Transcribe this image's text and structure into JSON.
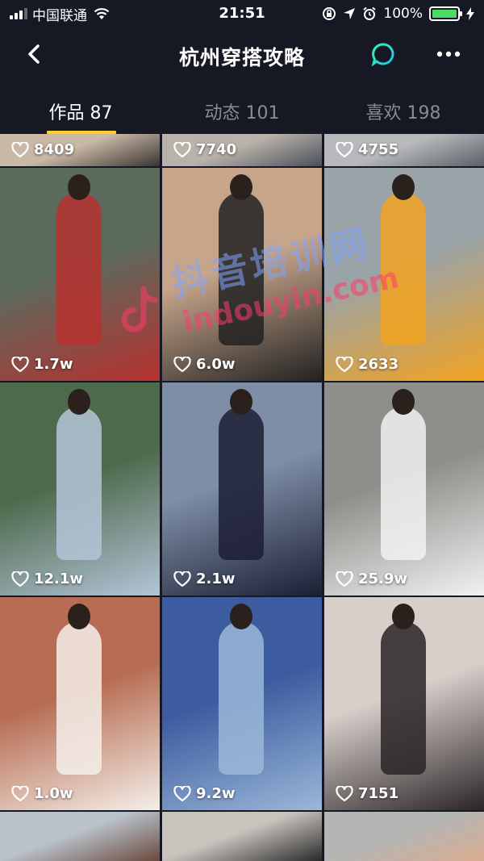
{
  "status_bar": {
    "carrier": "中国联通",
    "time": "21:51",
    "battery": "100%",
    "battery_level": 1.0
  },
  "nav": {
    "title": "杭州穿搭攻略"
  },
  "tabs": [
    {
      "label": "作品 87",
      "active": true
    },
    {
      "label": "动态 101",
      "active": false
    },
    {
      "label": "喜欢 198",
      "active": false
    }
  ],
  "watermark": {
    "cn": "抖音培训网",
    "en": "indouyin.com"
  },
  "videos": [
    {
      "likes": "8409",
      "colors": [
        "#c9b8a6",
        "#3a3531"
      ]
    },
    {
      "likes": "7740",
      "colors": [
        "#b9b2aa",
        "#4a4f5a"
      ]
    },
    {
      "likes": "4755",
      "colors": [
        "#b7b9bc",
        "#5b5f66"
      ]
    },
    {
      "likes": "1.7w",
      "colors": [
        "#5a6b5e",
        "#b7312f"
      ]
    },
    {
      "likes": "6.0w",
      "colors": [
        "#c7a58a",
        "#222"
      ]
    },
    {
      "likes": "2633",
      "colors": [
        "#9aa3a8",
        "#f2a321"
      ]
    },
    {
      "likes": "12.1w",
      "colors": [
        "#4d6a4c",
        "#b4c4d8"
      ]
    },
    {
      "likes": "2.1w",
      "colors": [
        "#7e8ea6",
        "#1c1f34"
      ]
    },
    {
      "likes": "25.9w",
      "colors": [
        "#8e8f8a",
        "#f1f1f1"
      ]
    },
    {
      "likes": "1.0w",
      "colors": [
        "#b76d53",
        "#f4efe9"
      ]
    },
    {
      "likes": "9.2w",
      "colors": [
        "#3d5b9f",
        "#9ab8d8"
      ]
    },
    {
      "likes": "7151",
      "colors": [
        "#d8cfcb",
        "#2b2527"
      ]
    },
    {
      "likes": "",
      "colors": [
        "#b9c1c9",
        "#6a4a3f"
      ]
    },
    {
      "likes": "",
      "colors": [
        "#c8c3bd",
        "#2a2a2a"
      ]
    },
    {
      "likes": "",
      "colors": [
        "#b4b6b5",
        "#d9ab8f"
      ]
    }
  ]
}
